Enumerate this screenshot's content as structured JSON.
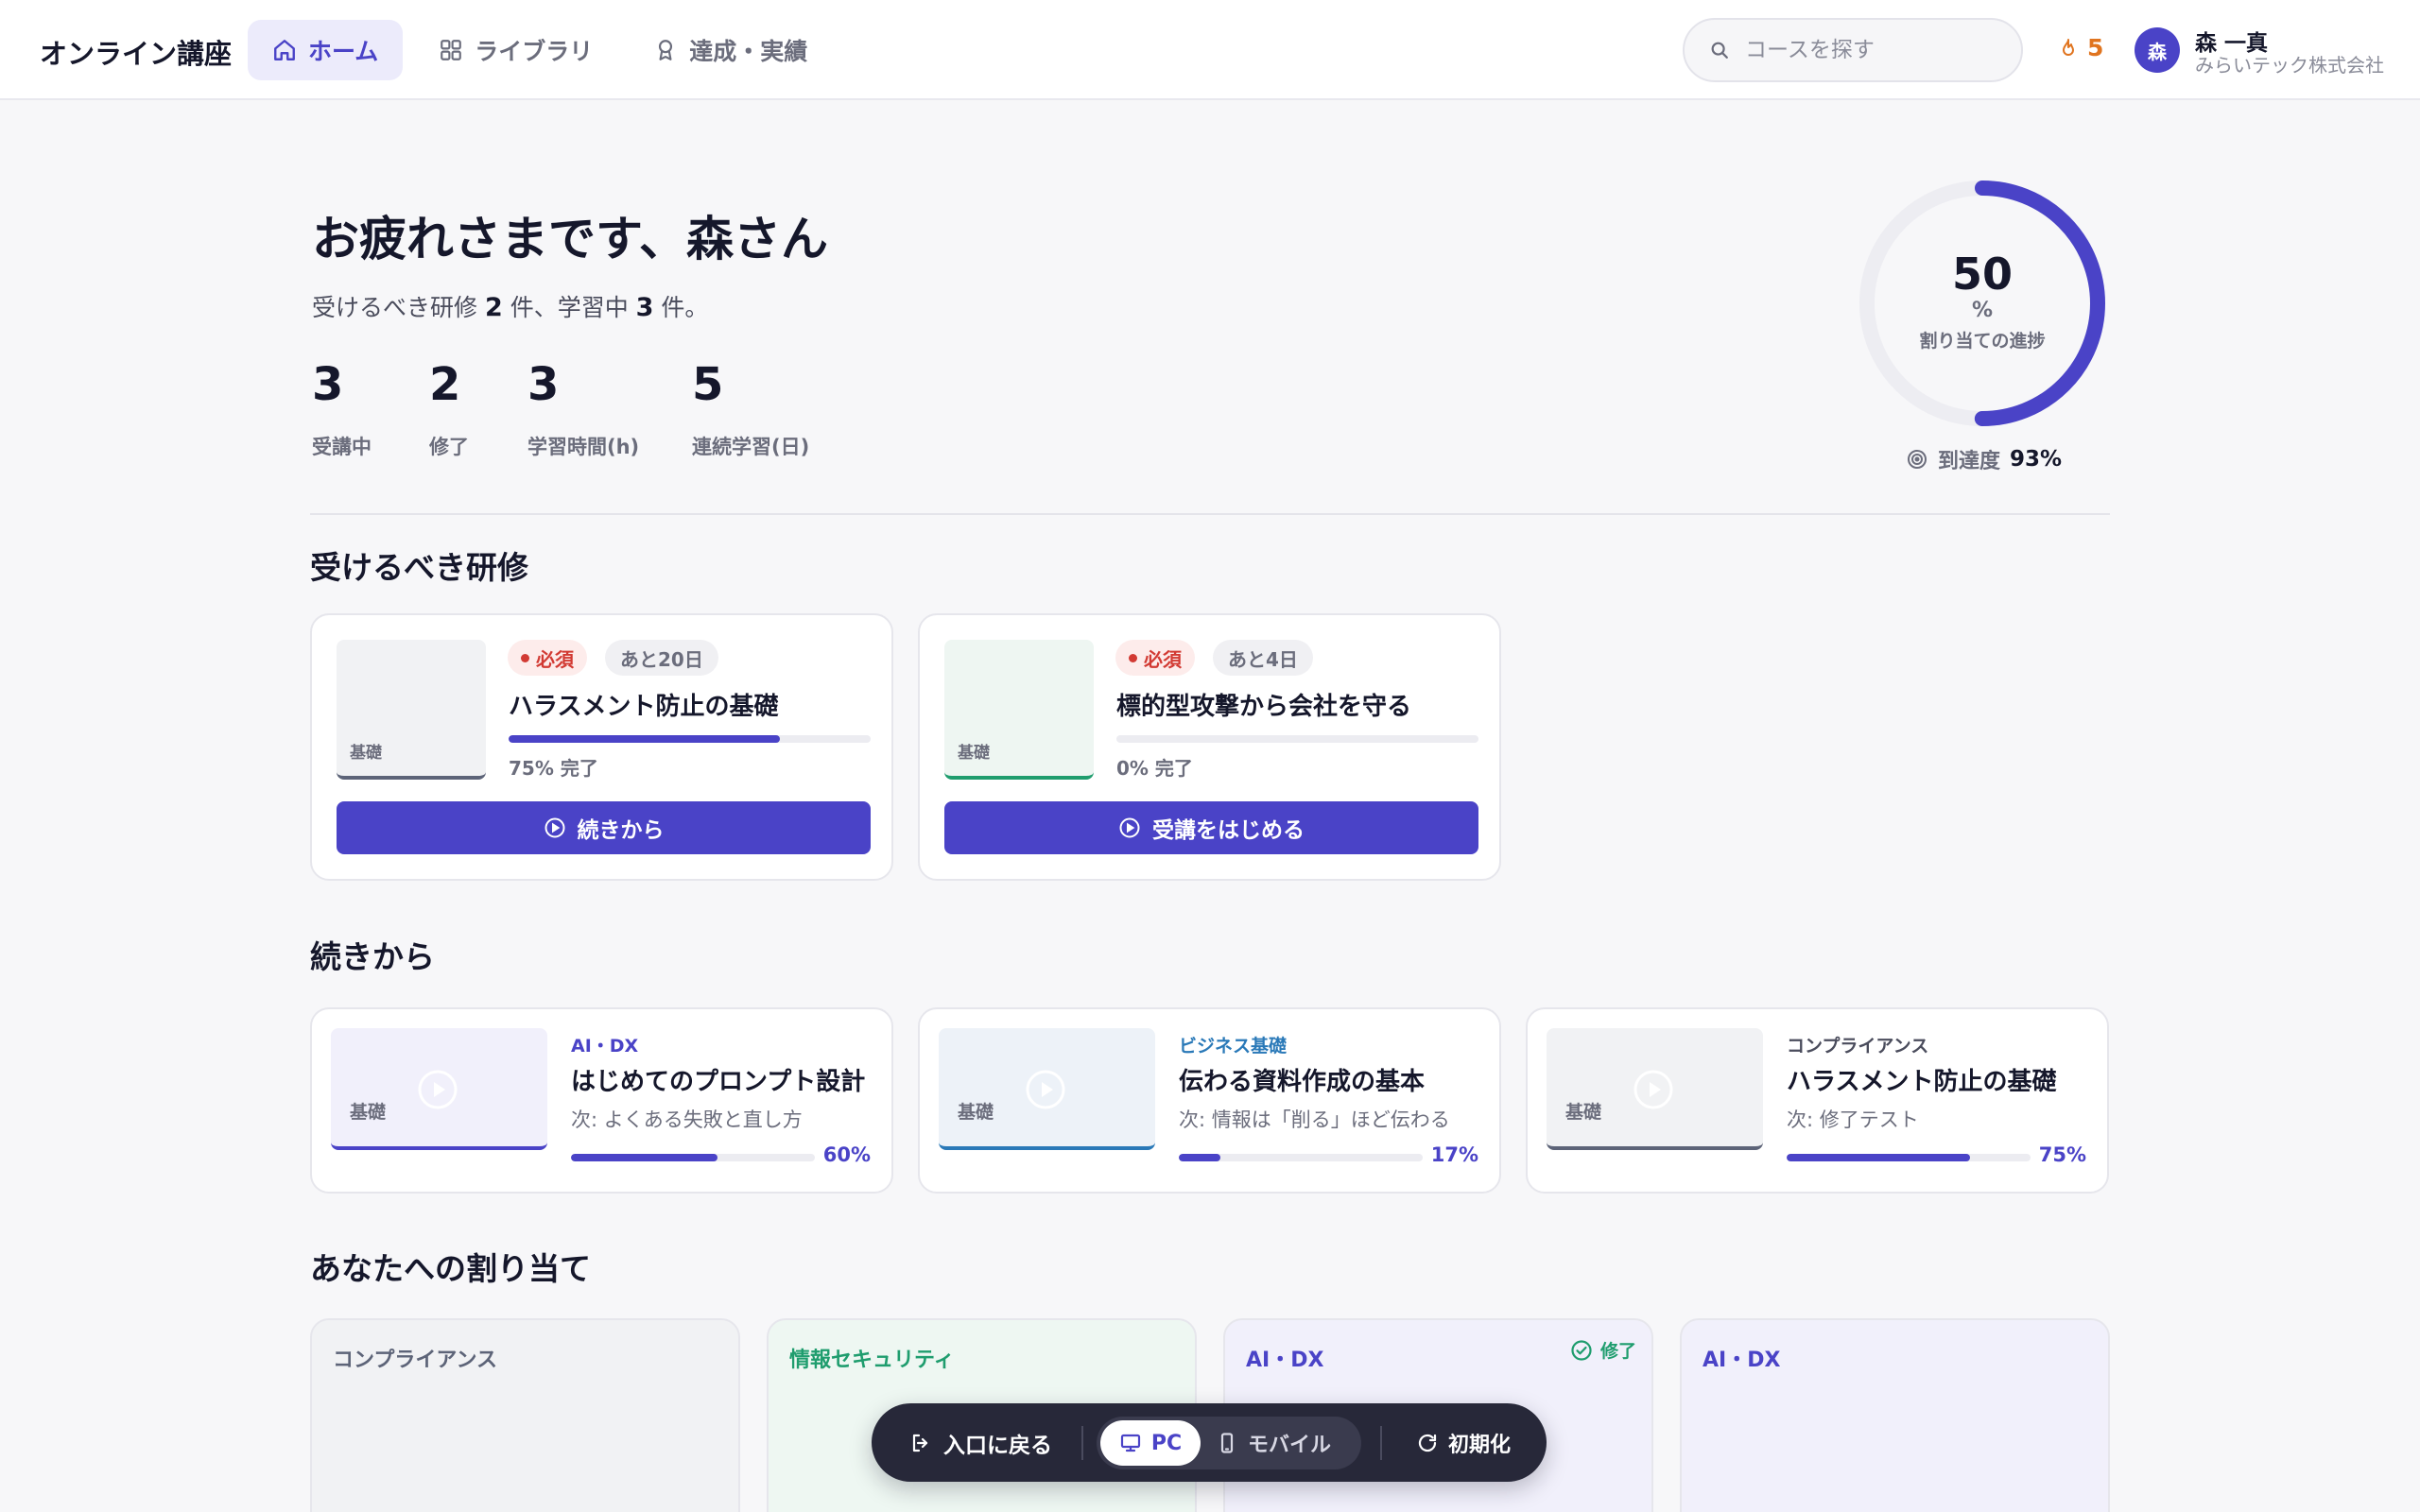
{
  "header": {
    "brand": "オンライン講座",
    "nav": [
      {
        "label": "ホーム",
        "active": true,
        "icon": "home-icon"
      },
      {
        "label": "ライブラリ",
        "active": false,
        "icon": "grid-icon"
      },
      {
        "label": "達成・実績",
        "active": false,
        "icon": "award-icon"
      }
    ],
    "search_placeholder": "コースを探す",
    "streak": "5",
    "user": {
      "avatar": "森",
      "name": "森 一真",
      "org": "みらいテック株式会社"
    }
  },
  "hero": {
    "greeting": "お疲れさまです、森さん",
    "subline_prefix": "受けるべき研修 ",
    "subline_required": "2",
    "subline_middle": " 件、学習中 ",
    "subline_learning": "3",
    "subline_suffix": " 件。",
    "stats": [
      {
        "value": "3",
        "label": "受講中"
      },
      {
        "value": "2",
        "label": "修了"
      },
      {
        "value": "3",
        "label": "学習時間(h)"
      },
      {
        "value": "5",
        "label": "連続学習(日)"
      }
    ],
    "progress": {
      "value": "50",
      "percent": 50,
      "unit": "%",
      "label": "割り当ての進捗"
    },
    "reach": {
      "label": "到達度",
      "value": "93%"
    }
  },
  "required": {
    "title": "受けるべき研修",
    "cards": [
      {
        "thumb_tag": "基礎",
        "badge": "必須",
        "due": "あと20日",
        "title": "ハラスメント防止の基礎",
        "progress": 75,
        "progress_text": "75% 完了",
        "button": "続きから"
      },
      {
        "thumb_tag": "基礎",
        "badge": "必須",
        "due": "あと4日",
        "title": "標的型攻撃から会社を守る",
        "progress": 0,
        "progress_text": "0% 完了",
        "button": "受講をはじめる"
      }
    ]
  },
  "continue": {
    "title": "続きから",
    "cards": [
      {
        "thumb_tag": "基礎",
        "category": "AI・DX",
        "category_color": "#4a43c7",
        "title": "はじめてのプロンプト設計",
        "next": "次: よくある失敗と直し方",
        "progress": 60,
        "progress_text": "60%"
      },
      {
        "thumb_tag": "基礎",
        "category": "ビジネス基礎",
        "category_color": "#2a79b8",
        "title": "伝わる資料作成の基本",
        "next": "次: 情報は「削る」ほど伝わる",
        "progress": 17,
        "progress_text": "17%"
      },
      {
        "thumb_tag": "基礎",
        "category": "コンプライアンス",
        "category_color": "#4a4c5c",
        "title": "ハラスメント防止の基礎",
        "next": "次: 修了テスト",
        "progress": 75,
        "progress_text": "75%"
      }
    ]
  },
  "assignments": {
    "title": "あなたへの割り当て",
    "cards": [
      {
        "category": "コンプライアンス",
        "category_color": "#5d6478"
      },
      {
        "category": "情報セキュリティ",
        "category_color": "#1f9d6e"
      },
      {
        "category": "AI・DX",
        "category_color": "#4a43c7",
        "done": "修了"
      },
      {
        "category": "AI・DX",
        "category_color": "#4a43c7"
      }
    ]
  },
  "toolbar": {
    "back": "入口に戻る",
    "pc": "PC",
    "mobile": "モバイル",
    "reset": "初期化"
  },
  "colors": {
    "accent": "#4a43c7",
    "danger": "#d23a33",
    "success": "#1f9d6e",
    "streak": "#e0741f"
  }
}
